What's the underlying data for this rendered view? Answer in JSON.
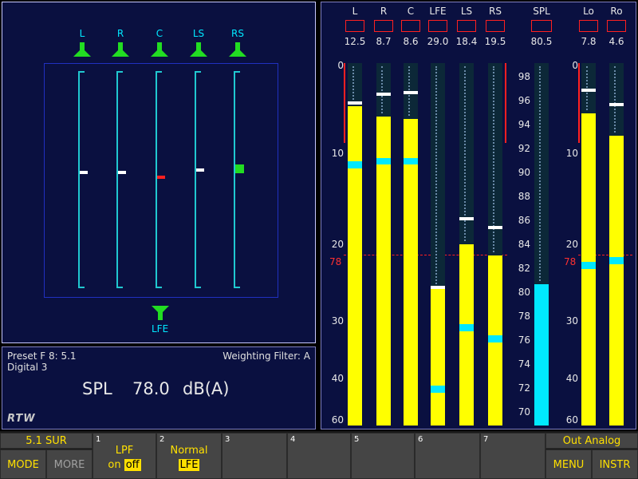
{
  "colors": {
    "accent": "#ffe000",
    "cyan": "#00e8ff",
    "green": "#22dd22",
    "red": "#ff2020",
    "panel": "#0a1040"
  },
  "surround": {
    "speakers": [
      "L",
      "R",
      "C",
      "LS",
      "RS"
    ],
    "lfe_label": "LFE",
    "indicators": [
      {
        "name": "L",
        "level": 0.54,
        "color": "#ffffff"
      },
      {
        "name": "R",
        "level": 0.54,
        "color": "#ffffff"
      },
      {
        "name": "C",
        "level": 0.52,
        "color": "#ff2020"
      },
      {
        "name": "LS",
        "level": 0.55,
        "color": "#ffffff"
      },
      {
        "name": "RS",
        "level": 0.57,
        "color": "#22dd22"
      }
    ]
  },
  "info": {
    "preset": "Preset F 8: 5.1",
    "source": "Digital 3",
    "weighting": "Weighting Filter: A",
    "spl_label": "SPL",
    "spl_value": "78.0",
    "spl_unit": "dB(A)",
    "logo": "RTW"
  },
  "meters": {
    "channels": [
      {
        "name": "L",
        "readout": "12.5",
        "level": 0.12,
        "peak": 0.105,
        "cyan_top": 0.272,
        "cyan_h": 0.018
      },
      {
        "name": "R",
        "readout": "8.7",
        "level": 0.148,
        "peak": 0.082,
        "cyan_top": 0.262,
        "cyan_h": 0.018
      },
      {
        "name": "C",
        "readout": "8.6",
        "level": 0.155,
        "peak": 0.078,
        "cyan_top": 0.262,
        "cyan_h": 0.018
      },
      {
        "name": "LFE",
        "readout": "29.0",
        "level": 0.62,
        "peak": 0.615,
        "cyan_top": 0.89,
        "cyan_h": 0.02
      },
      {
        "name": "LS",
        "readout": "18.4",
        "level": 0.5,
        "peak": 0.425,
        "cyan_top": 0.72,
        "cyan_h": 0.02
      },
      {
        "name": "RS",
        "readout": "19.5",
        "level": 0.53,
        "peak": 0.45,
        "cyan_top": 0.75,
        "cyan_h": 0.02
      }
    ],
    "downmix": [
      {
        "name": "Lo",
        "readout": "7.8",
        "level": 0.138,
        "peak": 0.07,
        "cyan_top": 0.548,
        "cyan_h": 0.02
      },
      {
        "name": "Ro",
        "readout": "4.6",
        "level": 0.2,
        "peak": 0.11,
        "cyan_top": 0.535,
        "cyan_h": 0.02
      }
    ],
    "spl": {
      "name": "SPL",
      "readout": "80.5",
      "level": 0.39
    },
    "scale_left": [
      "0",
      "10",
      "20",
      "30",
      "40",
      "60"
    ],
    "scale_right": [
      "0",
      "10",
      "20",
      "30",
      "40",
      "60"
    ],
    "spl_scale": [
      "98",
      "96",
      "94",
      "92",
      "90",
      "88",
      "86",
      "84",
      "82",
      "80",
      "78",
      "76",
      "74",
      "72",
      "70"
    ],
    "reference_label": "78"
  },
  "softkeys": {
    "mode_title": "5.1 SUR",
    "mode": "MODE",
    "more": "MORE",
    "k1_num": "1",
    "k1_line1": "LPF",
    "k1_on": "on",
    "k1_off": "off",
    "k2_num": "2",
    "k2_line1": "Normal",
    "k2_line2": "LFE",
    "k3_num": "3",
    "k4_num": "4",
    "k5_num": "5",
    "k6_num": "6",
    "k7_num": "7",
    "out_title": "Out Analog",
    "menu": "MENU",
    "instr": "INSTR"
  }
}
